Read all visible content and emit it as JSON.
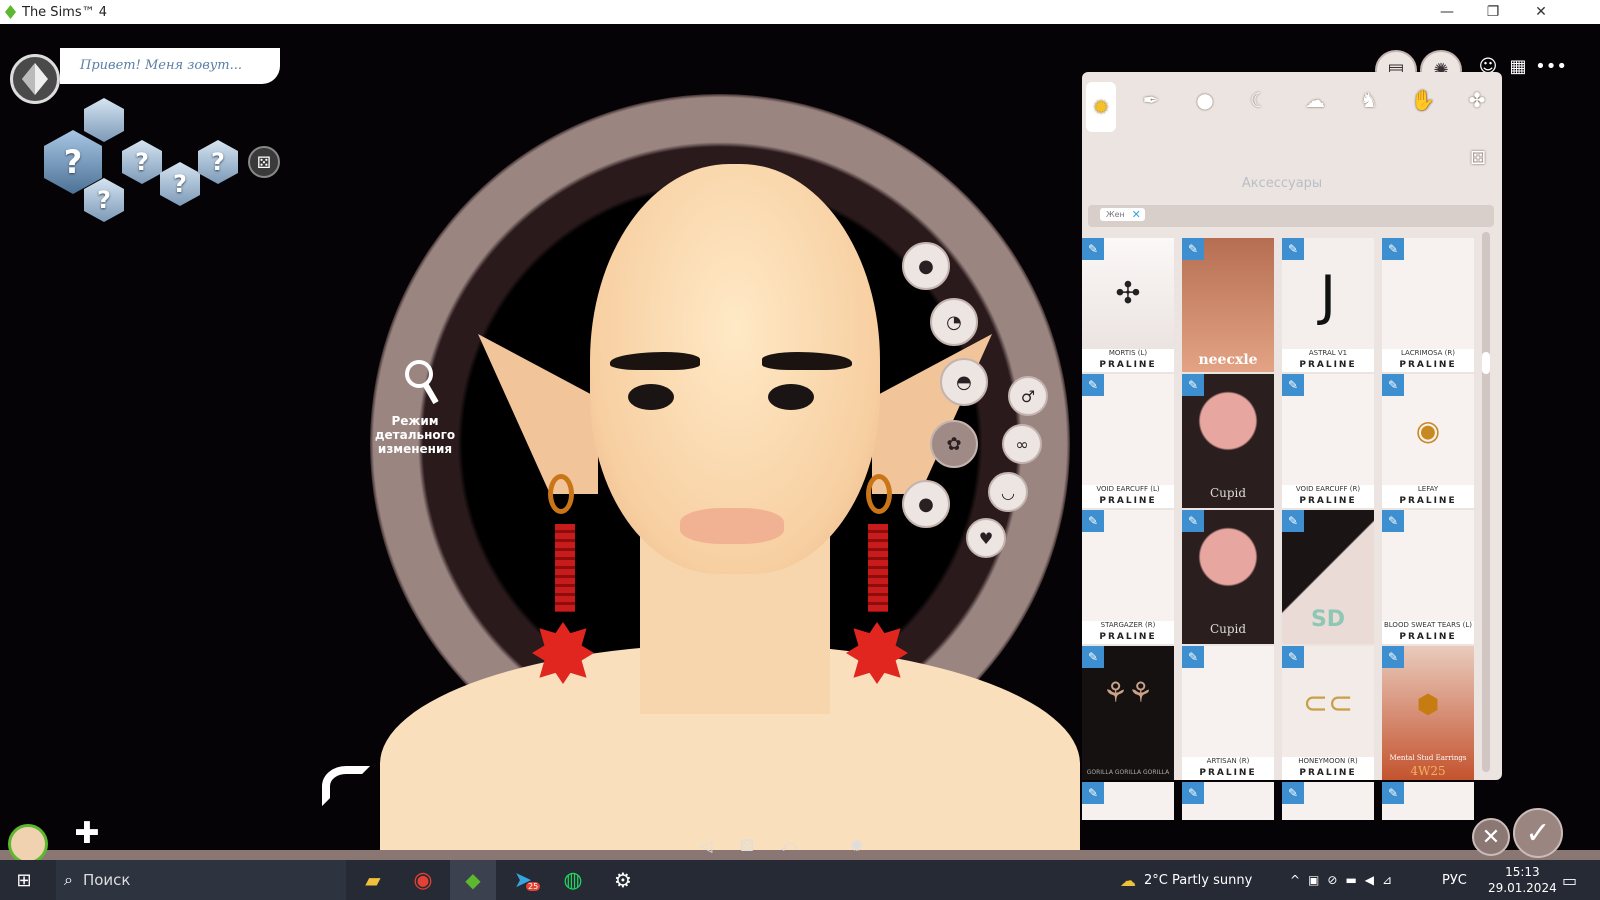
{
  "window": {
    "title": "The Sims™ 4",
    "minimize": "—",
    "restore": "❐",
    "close": "✕"
  },
  "name_prompt": "Привет! Меня зовут...",
  "household": {
    "slots": [
      "?",
      "?",
      "?",
      "?",
      "?"
    ],
    "randomize_icon": "dice-icon"
  },
  "detail_mode_label": "Режим детального изменения",
  "panel": {
    "category_title": "Аксессуары",
    "filter_chip": "Жен",
    "tabs": [
      "accessories-tab",
      "tie-tab",
      "ball-tab",
      "moon-tab",
      "cloud-tab",
      "shoe-tab",
      "glove-tab",
      "puzzle-tab"
    ],
    "items": [
      {
        "label": "MORTIS (L)",
        "brand": "PRALINE"
      },
      {
        "label": "neecxle",
        "brand": ""
      },
      {
        "label": "ASTRAL V1",
        "brand": "PRALINE"
      },
      {
        "label": "LACRIMOSA (R)",
        "brand": "PRALINE"
      },
      {
        "label": "VOID EARCUFF (L)",
        "brand": "PRALINE"
      },
      {
        "label": "Cupid",
        "brand": ""
      },
      {
        "label": "VOID EARCUFF (R)",
        "brand": "PRALINE"
      },
      {
        "label": "LEFAY",
        "brand": "PRALINE"
      },
      {
        "label": "STARGAZER (R)",
        "brand": "PRALINE"
      },
      {
        "label": "Cupid",
        "brand": ""
      },
      {
        "label": "SD",
        "brand": ""
      },
      {
        "label": "BLOOD SWEAT TEARS (L)",
        "brand": "PRALINE"
      },
      {
        "label": "GORILLA GORILLA GORILLA",
        "brand": ""
      },
      {
        "label": "ARTISAN (R)",
        "brand": "PRALINE"
      },
      {
        "label": "HONEYMOON (R)",
        "brand": "PRALINE"
      },
      {
        "label": "Mental Stud Earrings",
        "brand": "4W25"
      }
    ]
  },
  "taskbar": {
    "search_placeholder": "Поиск",
    "weather": "2°C  Partly sunny",
    "language": "РУС",
    "time": "15:13",
    "date": "29.01.2024",
    "telegram_badge": "25"
  },
  "colors": {
    "accent": "#3e8fcf",
    "panel": "#ebe4e0",
    "selected_outline": "#a8c63a"
  }
}
